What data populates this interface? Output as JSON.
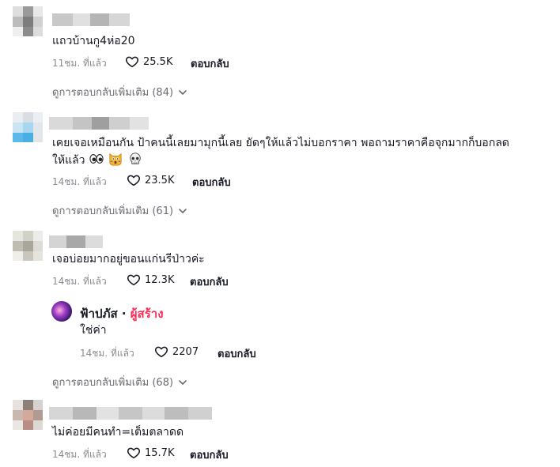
{
  "comments": [
    {
      "text": "แถวบ้านกู4ห่อ20",
      "time": "11ชม. ที่แล้ว",
      "likes": "25.5K",
      "reply_label": "ตอบกลับ",
      "more_replies": "ดูการตอบกลับเพิ่มเติม (84)"
    },
    {
      "text_line1": "เคยเจอเหมือนกัน ป้าคนนี้เลยมามุกนี้เลย ยัดๆให้แล้วไม่บอกราคา พอถามราคาคือจุกมากก็บอกลด",
      "text_line2": "ให้แล้ว",
      "emojis": [
        "eyes-emoji",
        "scream-cat-emoji",
        "skull-emoji"
      ],
      "time": "14ชม. ที่แล้ว",
      "likes": "23.5K",
      "reply_label": "ตอบกลับ",
      "more_replies": "ดูการตอบกลับเพิ่มเติม (61)"
    },
    {
      "text": "เจอบ่อยมากอยู่ขอนแก่นรีป่าวค่ะ",
      "time": "14ชม. ที่แล้ว",
      "likes": "12.3K",
      "reply_label": "ตอบกลับ",
      "reply": {
        "author": "ฟ้าปภัส",
        "separator": " · ",
        "badge": "ผู้สร้าง",
        "text": "ใช่ค่า",
        "time": "14ชม. ที่แล้ว",
        "likes": "2207",
        "reply_label": "ตอบกลับ"
      },
      "more_replies": "ดูการตอบกลับเพิ่มเติม (68)"
    },
    {
      "text": "ไม่ค่อยมีคนทำ=เต็มตลาดด",
      "time": "14ชม. ที่แล้ว",
      "likes": "15.7K",
      "reply_label": "ตอบกลับ"
    }
  ],
  "colors": {
    "creator_badge": "#fe2c55",
    "muted": "#8a8b91",
    "text": "#161823"
  }
}
